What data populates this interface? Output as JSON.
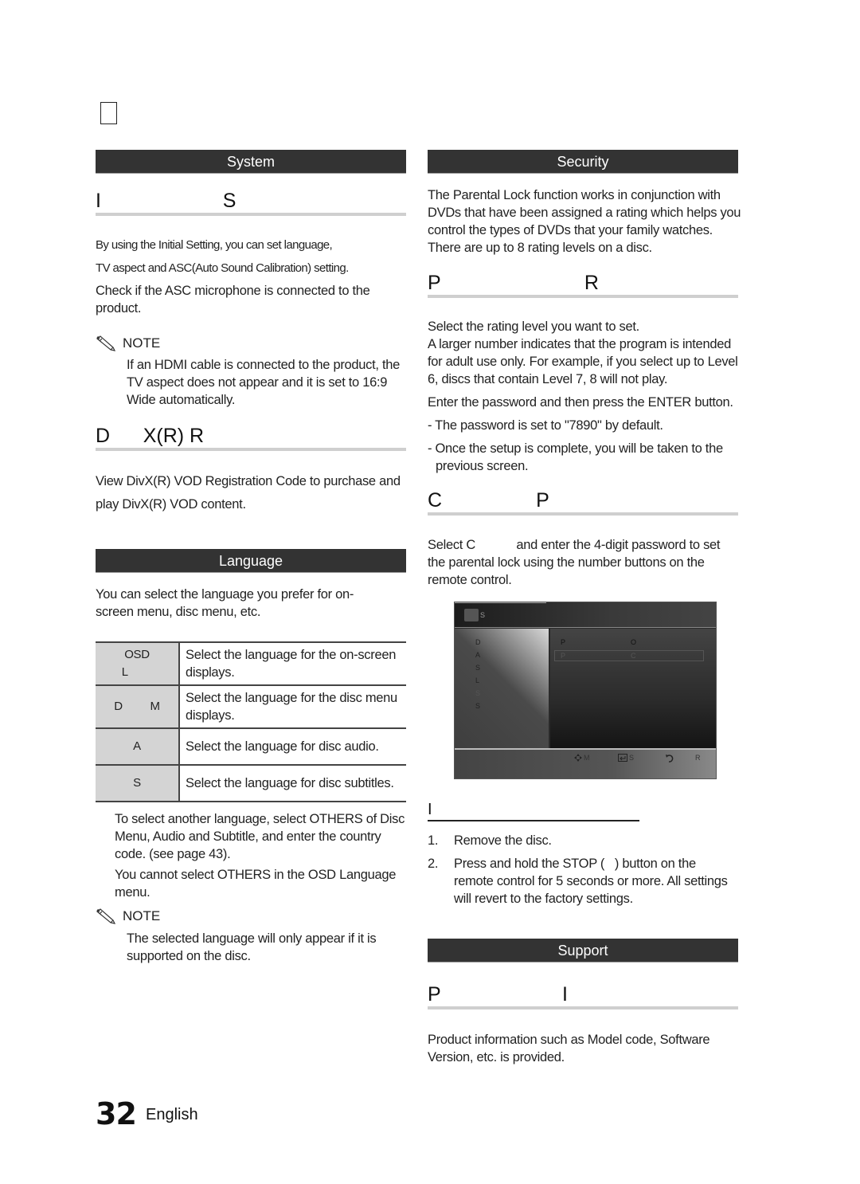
{
  "page": {
    "number": "32",
    "language": "English"
  },
  "left_column": {
    "system_bar": "System",
    "initial_setting": {
      "heading": "I                      S",
      "p1": "By using the Initial Setting, you can set language,",
      "p2": "TV aspect and ASC(Auto Sound Calibration) setting.",
      "p3": "Check if the ASC microphone is connected to the product.",
      "note_label": "NOTE",
      "note_text": "If an HDMI cable is connected to the product, the TV aspect does not appear and it is set to 16:9 Wide automatically."
    },
    "divx": {
      "heading": "D      X(R) R",
      "text": "View DivX(R) VOD Registration Code to purchase and play DivX(R) VOD content."
    },
    "language_bar": "Language",
    "language_intro": "You can select the language you prefer for on-screen menu, disc menu, etc.",
    "language_table": [
      {
        "label": "OSD\nL        ",
        "desc": "Select the language for the on-screen displays."
      },
      {
        "label": "D         M",
        "desc": "Select the language for the disc menu displays."
      },
      {
        "label": "A",
        "desc": "Select the language for disc audio."
      },
      {
        "label": "S",
        "desc": "Select the language for disc subtitles."
      }
    ],
    "lang_note1": "To select another language, select OTHERS of Disc Menu, Audio and Subtitle, and enter the country code. (see page 43).",
    "lang_note2": "You cannot select OTHERS in the OSD Language menu.",
    "note2_label": "NOTE",
    "note2_text": "The selected language will only appear if it is supported on the disc."
  },
  "right_column": {
    "security_bar": "Security",
    "security_intro": "The Parental Lock function works in conjunction with DVDs that have been assigned a rating which helps you control the types of DVDs that your family watches. There are up to 8 rating levels on a disc.",
    "parental_rating": {
      "heading": "P                          R",
      "p1": "Select the rating level you want to set.",
      "p2": "A larger number indicates that the program is intended for adult use only. For example, if you select up to Level 6, discs that contain Level 7, 8 will not play.",
      "p3": "Enter the password and then press the ENTER  button.",
      "b1": "- The password is set to \"7890\" by default.",
      "b2": "- Once the setup is complete, you will be taken to the previous screen."
    },
    "change_password": {
      "heading": "C                 P",
      "text": "Select C            and enter the 4-digit password to set the parental lock using the number buttons on the remote control."
    },
    "osd_screen": {
      "title": "S",
      "menu": [
        {
          "label": "D",
          "dim": false
        },
        {
          "label": "A",
          "dim": false
        },
        {
          "label": "S",
          "dim": false
        },
        {
          "label": "L",
          "dim": false
        },
        {
          "label": "S",
          "dim": true
        },
        {
          "label": "S",
          "dim": false
        }
      ],
      "rows": [
        {
          "name": "P",
          "value": "O"
        },
        {
          "name": "P",
          "value": "C"
        }
      ],
      "footer": {
        "move": "M",
        "select": "S",
        "return": "R"
      }
    },
    "reset": {
      "heading": "I",
      "steps": [
        {
          "num": "1.",
          "text": "Remove the disc."
        },
        {
          "num": "2.",
          "text": "Press and hold the STOP (   ) button on the remote control for 5 seconds or more. All settings will revert to the factory settings."
        }
      ]
    },
    "support_bar": "Support",
    "product_info": {
      "heading": "P                      I",
      "text": "Product information such as Model code, Software Version, etc. is provided."
    }
  }
}
